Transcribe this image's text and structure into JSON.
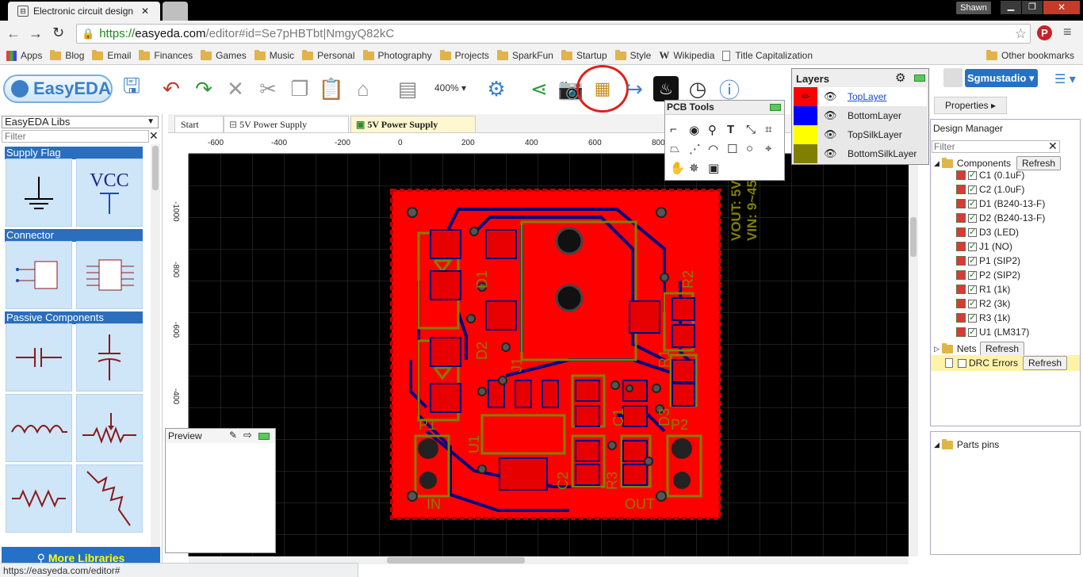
{
  "browser": {
    "tab_title": "Electronic circuit design -",
    "user": "Shawn",
    "url_scheme": "https://",
    "url_host": "easyeda.com",
    "url_path": "/editor#id=Se7pHBTbt|NmgyQ82kC",
    "status_url": "https://easyeda.com/editor#",
    "bookmarks": [
      "Apps",
      "Blog",
      "Email",
      "Finances",
      "Games",
      "Music",
      "Personal",
      "Photography",
      "Projects",
      "SparkFun",
      "Startup",
      "Style",
      "Wikipedia",
      "Title Capitalization"
    ],
    "other_bookmarks": "Other bookmarks"
  },
  "app": {
    "logo": "EasyEDA",
    "zoom": "400%",
    "user_button": "Sgmustadio",
    "properties_tab": "Properties",
    "lib_select": "EasyEDA Libs",
    "lib_filter_placeholder": "Filter",
    "more_libraries": "More Libraries",
    "tabs": [
      "Start",
      "5V Power Supply",
      "5V Power Supply"
    ]
  },
  "library": {
    "sections": [
      "Supply Flag",
      "Connector",
      "Passive Components"
    ],
    "vcc_label": "VCC"
  },
  "pcb_tools": {
    "title": "PCB Tools"
  },
  "layers": {
    "title": "Layers",
    "items": [
      {
        "name": "TopLayer",
        "color": "#ff0000"
      },
      {
        "name": "BottomLayer",
        "color": "#0000ff"
      },
      {
        "name": "TopSilkLayer",
        "color": "#ffff00"
      },
      {
        "name": "BottomSilkLayer",
        "color": "#808000"
      }
    ]
  },
  "preview": {
    "title": "Preview"
  },
  "design_manager": {
    "title": "Design Manager",
    "filter_placeholder": "Filter",
    "components_label": "Components",
    "refresh": "Refresh",
    "components": [
      "C1 (0.1uF)",
      "C2 (1.0uF)",
      "D1 (B240-13-F)",
      "D2 (B240-13-F)",
      "D3 (LED)",
      "J1 (NO)",
      "P1 (SIP2)",
      "P2 (SIP2)",
      "R1 (1k)",
      "R2 (3k)",
      "R3 (1k)",
      "U1 (LM317)"
    ],
    "nets_label": "Nets",
    "drc_label": "DRC Errors",
    "parts_pins": "Parts pins"
  },
  "rulers": {
    "top": [
      "-600",
      "-400",
      "-200",
      "0",
      "200",
      "400",
      "600",
      "800"
    ],
    "left": [
      "-1000",
      "-800",
      "-600",
      "-400"
    ]
  },
  "pcb_text": {
    "vout": "VOUT: 5V",
    "vin": "VIN: 9~45V",
    "labels": [
      "P1",
      "P2",
      "IN",
      "OUT",
      "U1",
      "D1",
      "D2",
      "D3",
      "C1",
      "C2",
      "R1",
      "R2",
      "R3",
      "J1"
    ]
  }
}
